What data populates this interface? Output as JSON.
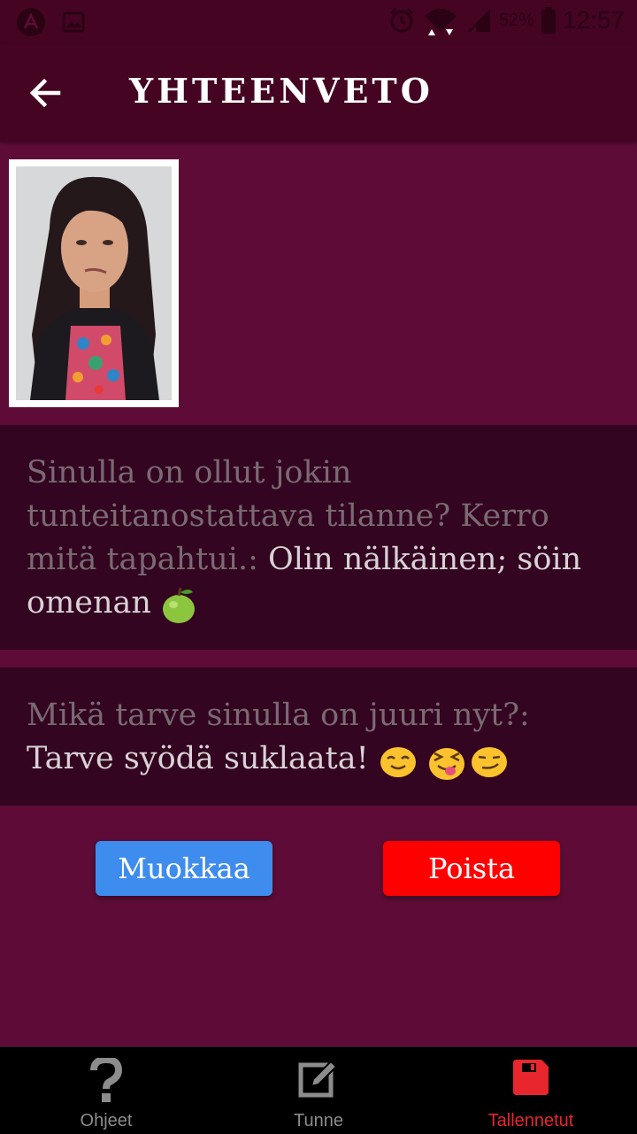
{
  "status_bar": {
    "battery": "52%",
    "time": "12:57"
  },
  "header": {
    "title": "YHTEENVETO"
  },
  "summary": {
    "items": [
      {
        "question": "Sinulla on ollut jokin tunteitanostattava tilanne? Kerro mitä tapahtui.:",
        "answer": " Olin nälkäinen; söin omenan "
      },
      {
        "question": "Mikä tarve sinulla on juuri nyt?:",
        "answer": " Tarve syödä suklaata! "
      }
    ]
  },
  "actions": {
    "edit_label": "Muokkaa",
    "delete_label": "Poista"
  },
  "bottom_nav": {
    "items": [
      {
        "label": "Ohjeet",
        "icon": "help-icon"
      },
      {
        "label": "Tunne",
        "icon": "edit-icon"
      },
      {
        "label": "Tallennetut",
        "icon": "save-icon"
      }
    ],
    "active_color": "#e8262e"
  },
  "colors": {
    "background": "#5e0c37",
    "header": "#440422",
    "card": "#330520",
    "edit_button": "#3e8ced",
    "delete_button": "#ff0000"
  }
}
